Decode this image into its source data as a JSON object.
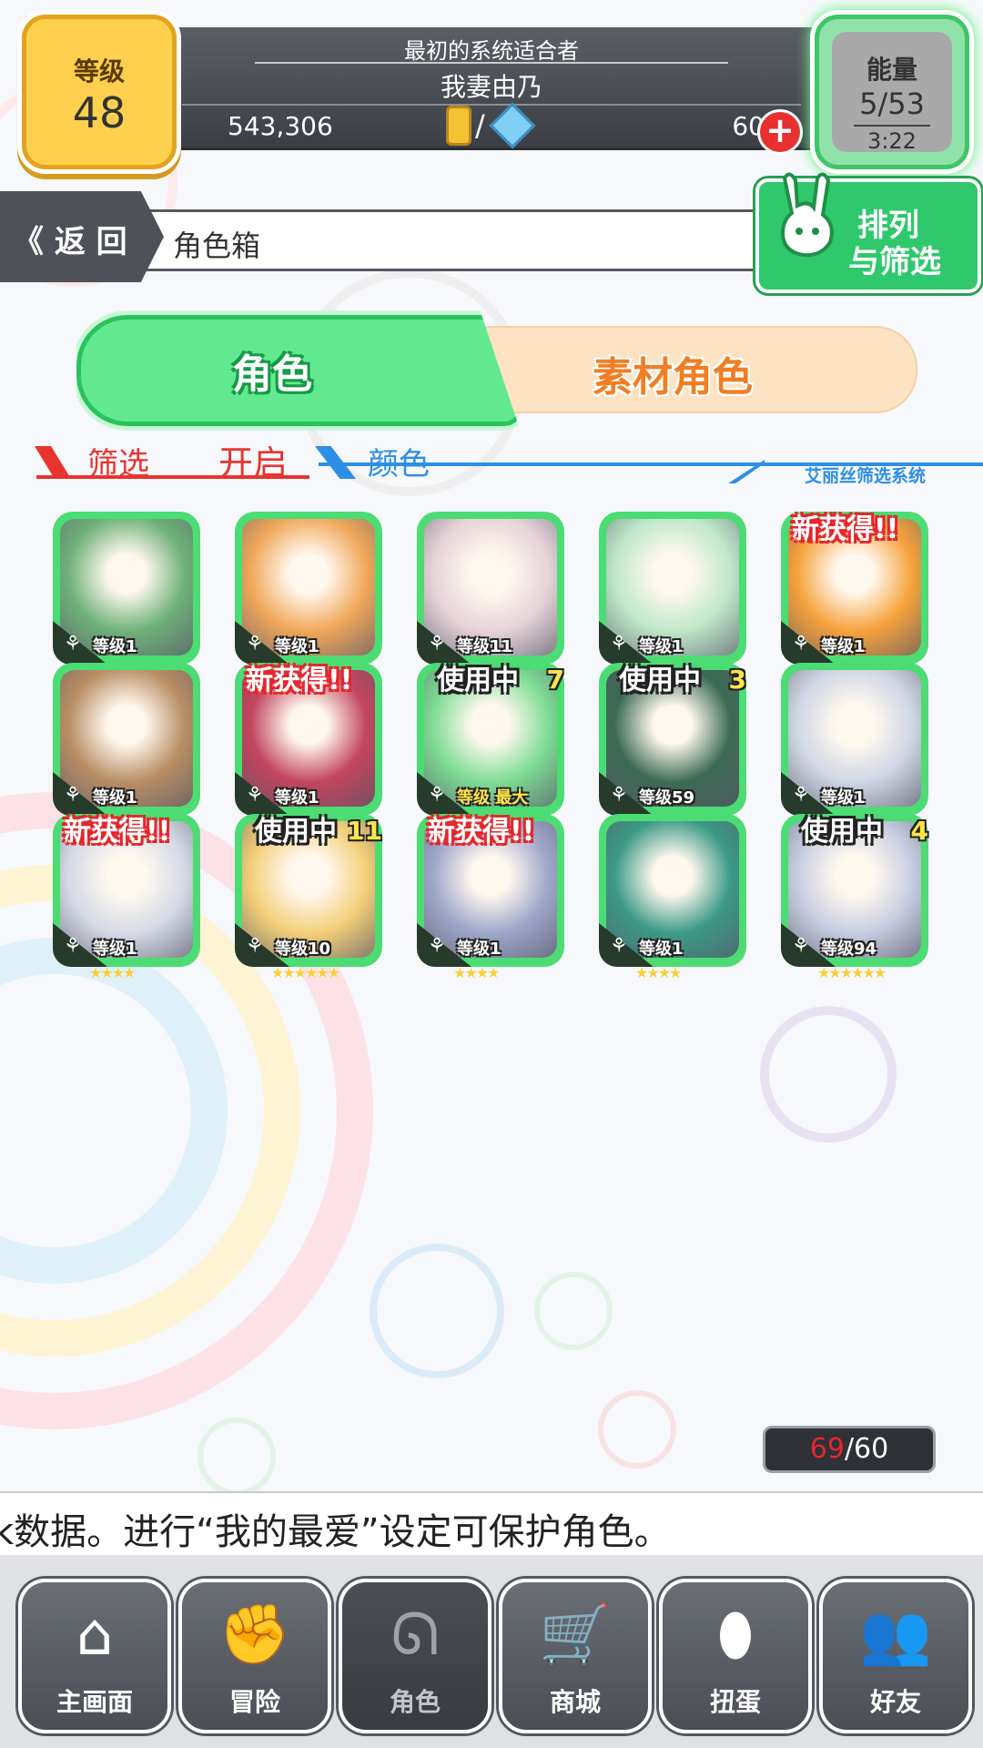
{
  "header": {
    "level_label": "等级",
    "level_value": "48",
    "subtitle": "最初的系统适合者",
    "player_name": "我妻由乃",
    "gold": "543,306",
    "separator": "/",
    "gems": "60",
    "plus_symbol": "+",
    "energy_label": "能量",
    "energy_value": "5/53",
    "energy_timer": "3:22"
  },
  "navbar": {
    "back_label": "《 返 回",
    "breadcrumb": "角色箱",
    "sort_line1": "排列",
    "sort_line2": "与筛选"
  },
  "tabs": [
    {
      "label": "角色",
      "active": true
    },
    {
      "label": "素材角色",
      "active": false
    }
  ],
  "filter": {
    "filter_label": "筛选",
    "filter_value": "开启",
    "color_label": "颜色",
    "system_label": "艾丽丝筛选系统"
  },
  "characters": [
    {
      "level": "等级1",
      "stars": "★",
      "badge": "",
      "color": "#6fb17a"
    },
    {
      "level": "等级1",
      "stars": "★★★★",
      "badge": "",
      "color": "#f0a85a"
    },
    {
      "level": "等级11",
      "stars": "★★★★★",
      "badge": "",
      "color": "#e6d3d8"
    },
    {
      "level": "等级1",
      "stars": "★★★★",
      "badge": "",
      "color": "#bfe7c9"
    },
    {
      "level": "等级1",
      "stars": "★★★★",
      "badge": "新获得!!",
      "color": "#f5a23b"
    },
    {
      "level": "等级1",
      "stars": "★★★★",
      "badge": "",
      "color": "#b98e63"
    },
    {
      "level": "等级1",
      "stars": "★★★★★",
      "badge": "新获得!!",
      "color": "#c2455e"
    },
    {
      "level": "等级 最大",
      "stars": "★★★★★",
      "badge": "使用中",
      "badge_num": "7",
      "color": "#7edc94",
      "max": true
    },
    {
      "level": "等级59",
      "stars": "★★★★",
      "badge": "使用中",
      "badge_num": "3",
      "color": "#3c6b54"
    },
    {
      "level": "等级1",
      "stars": "★★★★",
      "badge": "",
      "color": "#cfd6e4"
    },
    {
      "level": "等级1",
      "stars": "★★★★",
      "badge": "新获得!!",
      "color": "#d5dae6"
    },
    {
      "level": "等级10",
      "stars": "★★★★★★",
      "badge": "使用中",
      "badge_num": "11",
      "color": "#f3cf78"
    },
    {
      "level": "等级1",
      "stars": "★★★★",
      "badge": "新获得!!",
      "color": "#9ea6c9"
    },
    {
      "level": "等级1",
      "stars": "★★★★",
      "badge": "",
      "color": "#3c9a86"
    },
    {
      "level": "等级94",
      "stars": "★★★★★★",
      "badge": "使用中",
      "badge_num": "4",
      "color": "#c7cde0"
    }
  ],
  "inventory": {
    "current": "69",
    "slash": "/",
    "max": "60"
  },
  "tip": {
    "text": "k数据。进行“我的最爱”设定可保护角色。"
  },
  "bottom_nav": [
    {
      "label": "主画面",
      "icon": "home-icon",
      "glyph": "⌂"
    },
    {
      "label": "冒险",
      "icon": "handshake-icon",
      "glyph": "✊"
    },
    {
      "label": "角色",
      "icon": "rabbit-icon",
      "glyph": "ᘏ"
    },
    {
      "label": "商城",
      "icon": "cart-icon",
      "glyph": "🛒"
    },
    {
      "label": "扭蛋",
      "icon": "egg-icon",
      "glyph": "⬮"
    },
    {
      "label": "好友",
      "icon": "friends-icon",
      "glyph": "👥"
    }
  ],
  "colors": {
    "accent_green": "#4bdc74",
    "accent_orange": "#f07e22",
    "filter_red": "#e9332e",
    "filter_blue": "#2d8ee6"
  }
}
